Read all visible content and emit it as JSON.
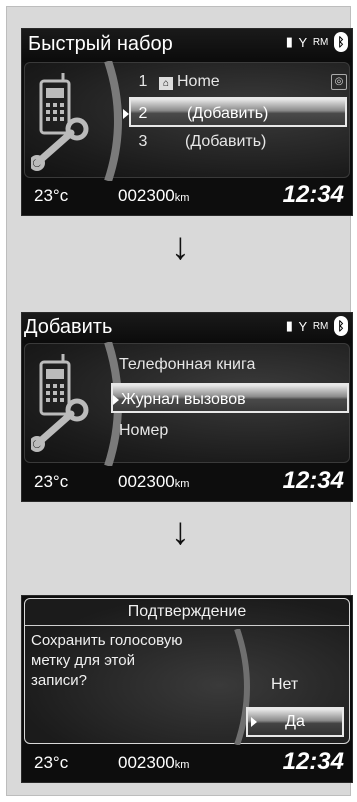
{
  "screens": [
    {
      "title": "Быстрый набор",
      "status_text": "RM",
      "items": [
        {
          "num": "1",
          "label": "Home",
          "icon": "home-icon"
        },
        {
          "num": "2",
          "label": "(Добавить)"
        },
        {
          "num": "3",
          "label": "(Добавить)"
        }
      ],
      "bottom": {
        "temp": "23°c",
        "odo": "002300",
        "odo_unit": "km",
        "clock": "12:34"
      }
    },
    {
      "title": "Добавить",
      "status_text": "RM",
      "items": [
        {
          "label": "Телефонная книга"
        },
        {
          "label": "Журнал вызовов"
        },
        {
          "label": "Номер"
        }
      ],
      "bottom": {
        "temp": "23°c",
        "odo": "002300",
        "odo_unit": "km",
        "clock": "12:34"
      }
    },
    {
      "confirm_title": "Подтверждение",
      "message_lines": [
        "Сохранить голосовую",
        "метку для этой",
        "записи?"
      ],
      "options": {
        "no": "Нет",
        "yes": "Да"
      },
      "bottom": {
        "temp": "23°c",
        "odo": "002300",
        "odo_unit": "km",
        "clock": "12:34"
      }
    }
  ],
  "arrow_glyph": "↓",
  "icons": [
    "phone-icon",
    "wrench-icon",
    "bluetooth-icon",
    "signal-icon",
    "battery-icon",
    "voice-tag-icon"
  ]
}
